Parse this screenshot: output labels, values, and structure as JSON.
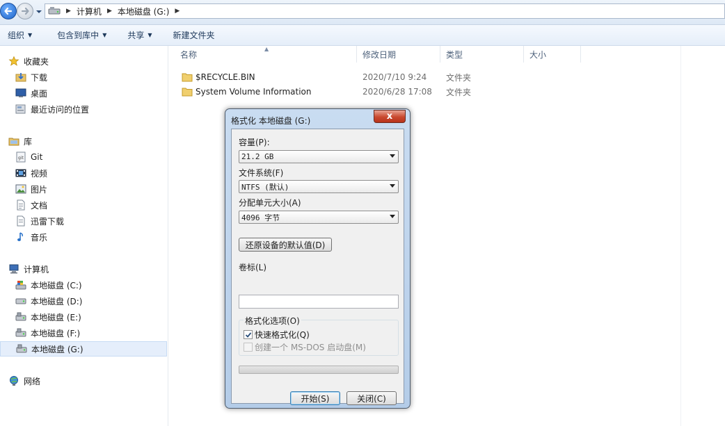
{
  "address": {
    "segments": [
      "计算机",
      "本地磁盘 (G:)"
    ]
  },
  "toolbar": {
    "organize": "组织",
    "include_library": "包含到库中",
    "share": "共享",
    "new_folder": "新建文件夹"
  },
  "sidebar": {
    "favorites": "收藏夹",
    "downloads": "下载",
    "desktop": "桌面",
    "recent": "最近访问的位置",
    "libraries": "库",
    "git": "Git",
    "video": "视频",
    "pictures": "图片",
    "documents": "文档",
    "thunder": "迅雷下载",
    "music": "音乐",
    "computer": "计算机",
    "drive_c": "本地磁盘 (C:)",
    "drive_d": "本地磁盘 (D:)",
    "drive_e": "本地磁盘 (E:)",
    "drive_f": "本地磁盘 (F:)",
    "drive_g": "本地磁盘 (G:)",
    "network": "网络"
  },
  "columns": {
    "name": "名称",
    "modified": "修改日期",
    "type": "类型",
    "size": "大小"
  },
  "files": [
    {
      "name": "$RECYCLE.BIN",
      "date": "2020/7/10 9:24",
      "type": "文件夹"
    },
    {
      "name": "System Volume Information",
      "date": "2020/6/28 17:08",
      "type": "文件夹"
    }
  ],
  "dialog": {
    "title": "格式化 本地磁盘 (G:)",
    "close": "x",
    "capacity_label": "容量(P):",
    "capacity_value": "21.2 GB",
    "fs_label": "文件系统(F)",
    "fs_value": "NTFS (默认)",
    "alloc_label": "分配单元大小(A)",
    "alloc_value": "4096 字节",
    "restore_defaults": "还原设备的默认值(D)",
    "volume_label": "卷标(L)",
    "volume_value": "",
    "options_title": "格式化选项(O)",
    "quick_format": "快速格式化(Q)",
    "quick_format_checked": true,
    "msdos_boot": "创建一个 MS-DOS 启动盘(M)",
    "start": "开始(S)",
    "close_btn": "关闭(C)"
  },
  "colors": {
    "accent": "#1d63c8",
    "close_red": "#c9492f",
    "toolbar_text": "#1e395b"
  }
}
